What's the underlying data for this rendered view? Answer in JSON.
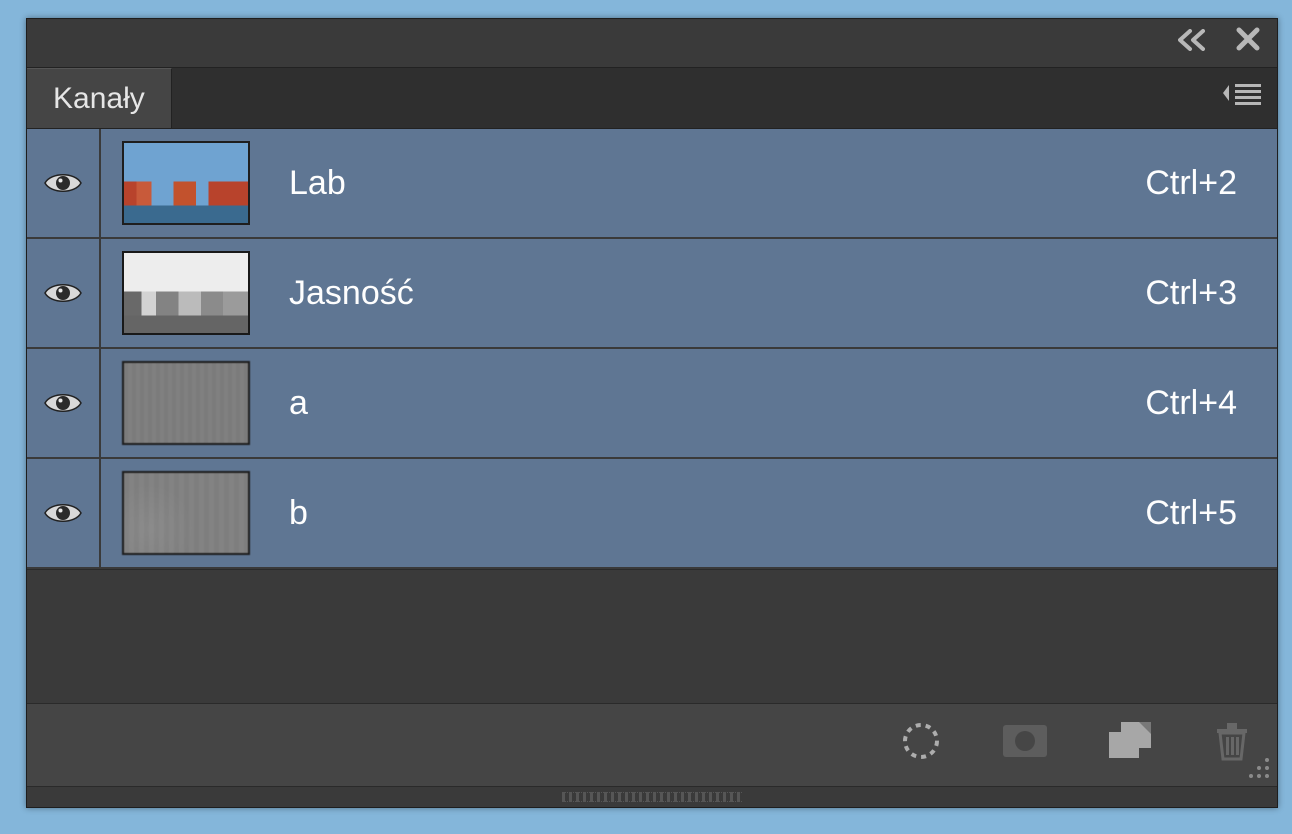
{
  "panel": {
    "tab_label": "Kanały",
    "collapse_icon": "double-chevron-left-icon",
    "close_icon": "close-icon",
    "menu_icon": "panel-menu-icon"
  },
  "channels": [
    {
      "name": "Lab",
      "shortcut": "Ctrl+2",
      "thumb": "lab"
    },
    {
      "name": "Jasność",
      "shortcut": "Ctrl+3",
      "thumb": "lightness"
    },
    {
      "name": "a",
      "shortcut": "Ctrl+4",
      "thumb": "gray-a"
    },
    {
      "name": "b",
      "shortcut": "Ctrl+5",
      "thumb": "gray-b"
    }
  ],
  "footer": {
    "load_selection_icon": "dashed-circle-icon",
    "save_selection_icon": "mask-icon",
    "new_channel_icon": "new-layer-icon",
    "delete_icon": "trash-icon"
  }
}
